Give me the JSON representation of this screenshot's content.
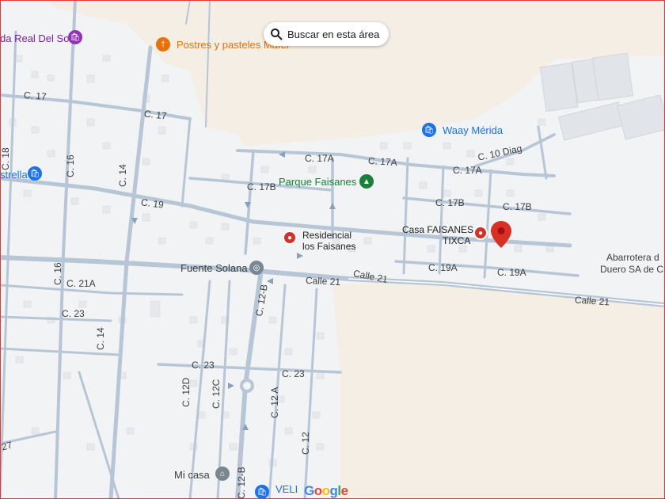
{
  "search_area_button": {
    "label": "Buscar en esta área",
    "icon": "search-icon"
  },
  "streets": {
    "c17_left": "C. 17",
    "c17_mid": "C. 17",
    "c18": "C. 18",
    "c16_top": "C. 16",
    "c14_top": "C. 14",
    "c19": "C. 19",
    "c17a_a": "C. 17A",
    "c17a_b": "C. 17A",
    "c17a_c": "C. 17A",
    "c17b_left": "C. 17B",
    "c17b_mid": "C. 17B",
    "c17b_right": "C. 17B",
    "c10diag": "C. 10 Diag",
    "c16_bottom": "C. 16",
    "c21a": "C. 21A",
    "c23_left": "C. 23",
    "c14_bottom": "C. 14",
    "c12b_top": "C. 12-B",
    "calle21_a": "Calle 21",
    "calle21_b": "Calle 21",
    "calle21_c": "Calle 21",
    "c19a_a": "C. 19A",
    "c19a_b": "C. 19A",
    "c23_mid": "C. 23",
    "c23_right": "C. 23",
    "c12d": "C. 12D",
    "c12c": "C. 12C",
    "c12a": "C. 12 A",
    "c12": "C. 12",
    "c12b_bottom": "C. 12-B",
    "c27": "27"
  },
  "places": {
    "real_del_sol": {
      "label": "da Real Del Sol",
      "icon": "shopping-bag-icon"
    },
    "postres": {
      "label": "Postres y pasteles Mafer",
      "icon": "fork-knife-icon",
      "color": "#e8710a"
    },
    "waay_merida": {
      "label": "Waay Mérida",
      "icon": "shopping-bag-icon",
      "color": "#1a73e8"
    },
    "estrella": {
      "label": "strella",
      "icon": "shopping-bag-icon"
    },
    "parque_faisanes": {
      "label": "Parque Faisanes",
      "icon": "tree-icon",
      "color": "#188038"
    },
    "residencial": {
      "line1": "Residencial",
      "line2": "los Faisanes",
      "icon": "pin-icon",
      "color": "#d93025"
    },
    "casa_faisanes": {
      "line1": "Casa FAISANES",
      "line2": "TIXCA",
      "icon": "pin-icon",
      "color": "#d93025"
    },
    "fuente_solana": {
      "label": "Fuente Solana",
      "icon": "fountain-icon"
    },
    "abarrotera": {
      "line1": "Abarrotera d",
      "line2": "Duero SA de C"
    },
    "mi_casa": {
      "label": "Mi casa",
      "icon": "home-icon"
    },
    "veli": {
      "label": "VELI",
      "icon": "shopping-bag-icon"
    }
  },
  "google_logo": "Google",
  "colors": {
    "map_bg": "#f1f3f4",
    "sand": "#f5eee4",
    "road": "#b7c6d6",
    "building": "#e6e8ec",
    "pin_red": "#d93025",
    "park_green": "#188038",
    "shop_purple": "#7b1fa2",
    "shop_blue": "#1a73e8",
    "food_orange": "#e8710a"
  }
}
